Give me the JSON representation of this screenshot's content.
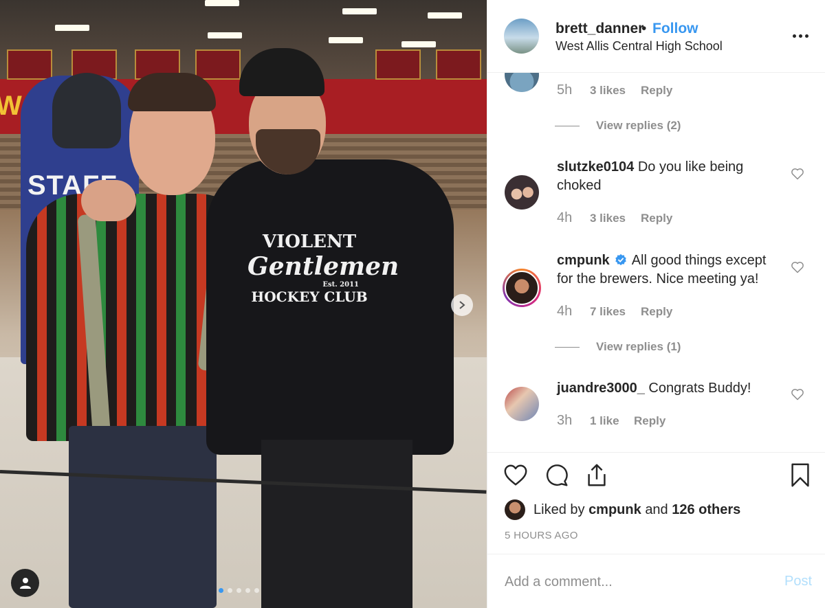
{
  "post": {
    "username": "brett_danner",
    "separator": "•",
    "follow_label": "Follow",
    "location": "West Allis Central High School"
  },
  "photo": {
    "welcome_banner": "Welco",
    "staff_shirt": "STAFF",
    "hoodie_line1": "VIOLENT",
    "hoodie_line2": "Gentlemen",
    "hoodie_line3": "Est. 2011",
    "hoodie_line4": "HOCKEY CLUB",
    "carousel_count": 5,
    "carousel_active_index": 0
  },
  "comments": {
    "first_partial": {
      "time": "5h",
      "likes": "3 likes",
      "reply": "Reply"
    },
    "view_replies_1": "View replies (2)",
    "items": [
      {
        "username": "slutzke0104",
        "text": "Do you like being choked",
        "time": "4h",
        "likes": "3 likes",
        "reply": "Reply"
      },
      {
        "username": "cmpunk",
        "text": "All good things except for the brewers. Nice meeting ya!",
        "time": "4h",
        "likes": "7 likes",
        "reply": "Reply"
      },
      {
        "username": "juandre3000_",
        "text": "Congrats Buddy!",
        "time": "3h",
        "likes": "1 like",
        "reply": "Reply"
      }
    ],
    "view_replies_2": "View replies (1)"
  },
  "actions": {
    "liked_prefix": "Liked by",
    "liked_user": "cmpunk",
    "liked_and": "and",
    "liked_others": "126 others",
    "timestamp": "5 HOURS AGO"
  },
  "add_comment": {
    "placeholder": "Add a comment...",
    "post_label": "Post"
  },
  "colors": {
    "link_blue": "#3897f0",
    "post_disabled": "#b2dffc",
    "secondary_text": "#8e8e8e",
    "primary_text": "#262626",
    "divider": "#efefef"
  }
}
